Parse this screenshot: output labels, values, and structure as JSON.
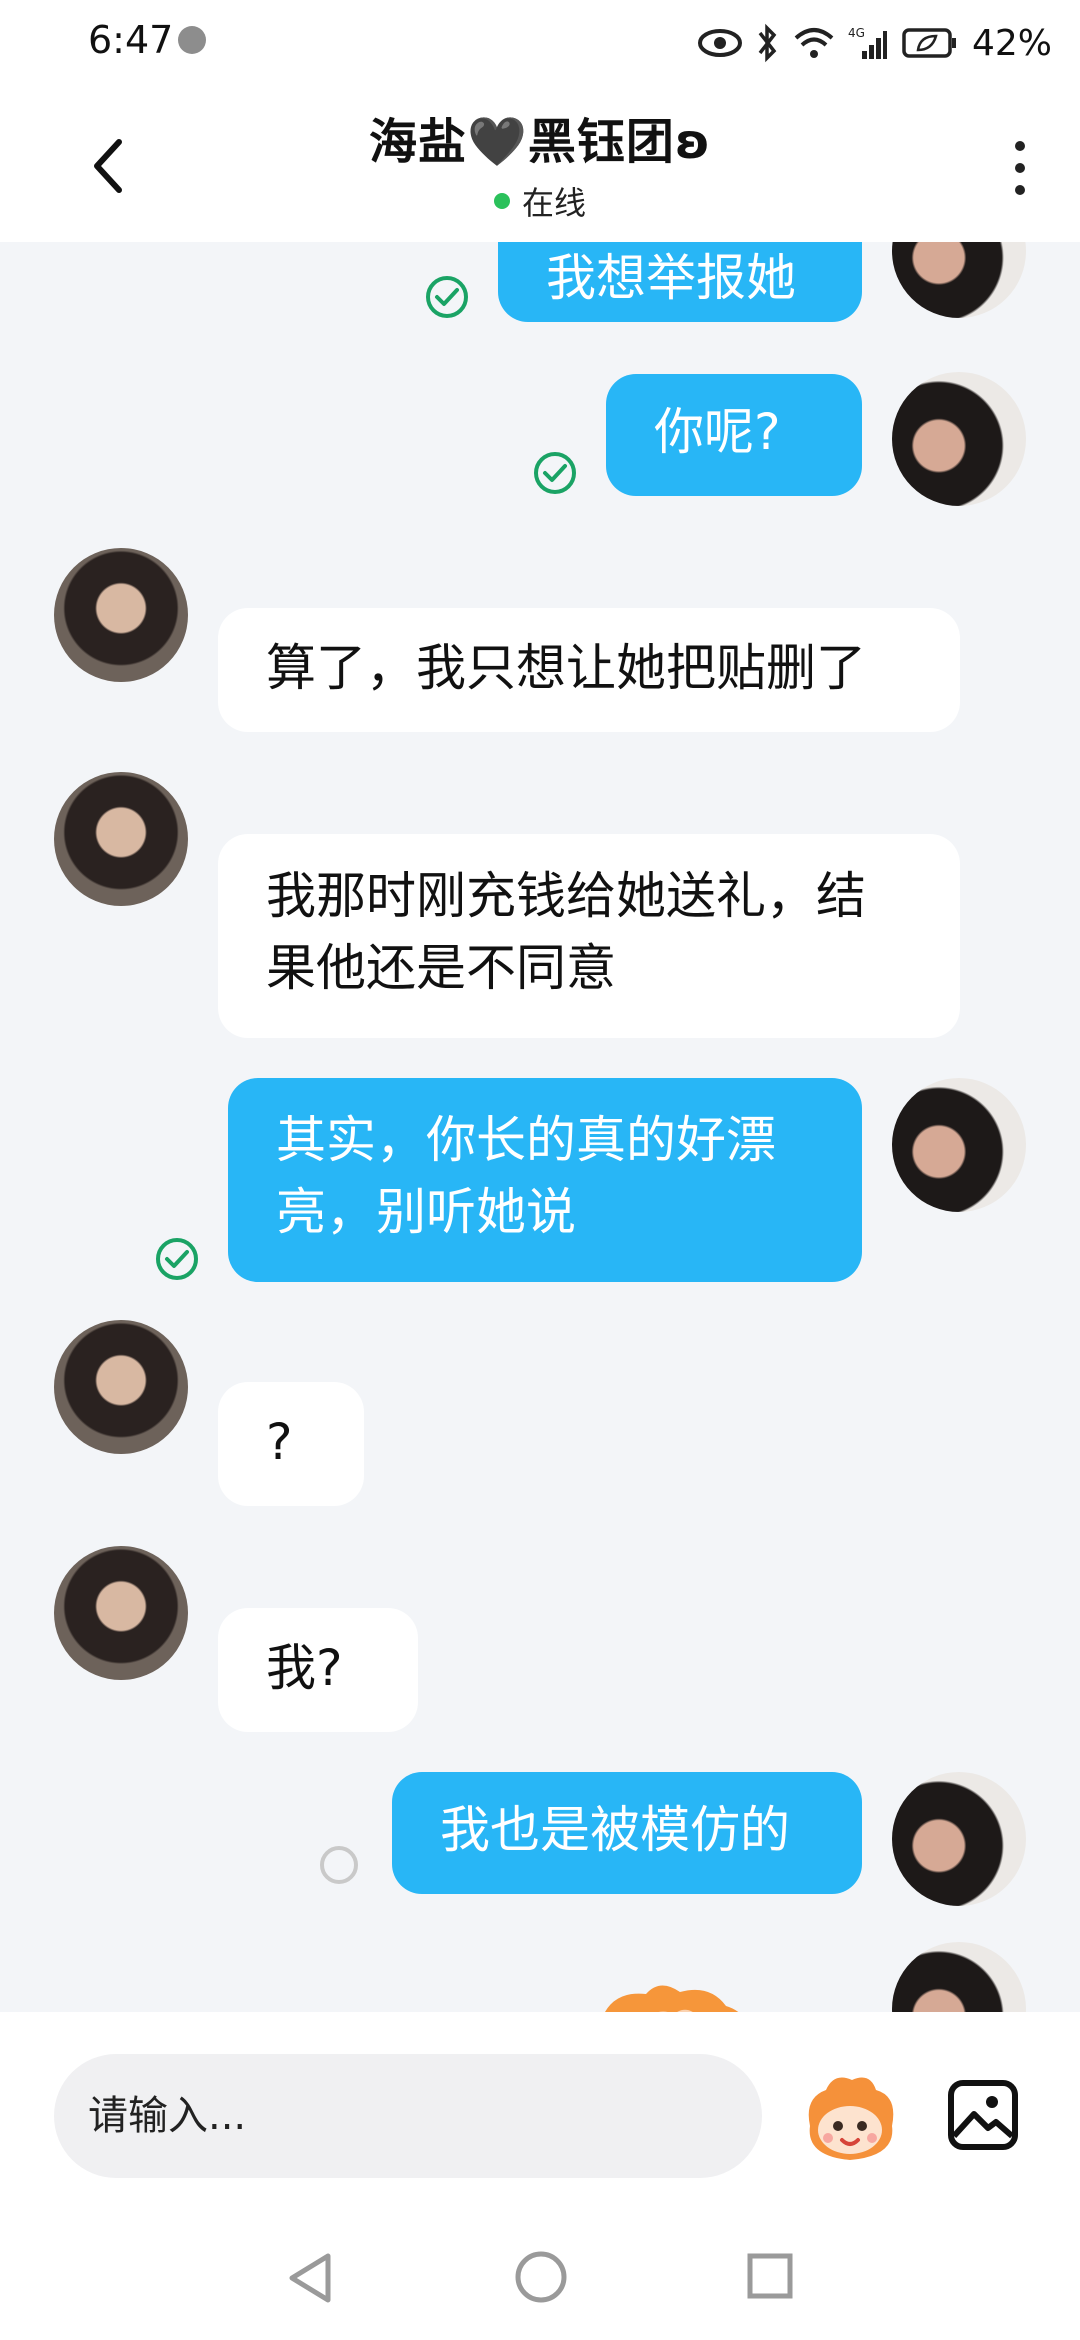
{
  "status_bar": {
    "time": "6:47",
    "network": "4G",
    "battery": "42%"
  },
  "header": {
    "title": "海盐🖤黑钰团ʚ",
    "status": "在线"
  },
  "messages": [
    {
      "direction": "outgoing",
      "text": "我想举报她",
      "status": "sent"
    },
    {
      "direction": "outgoing",
      "text": "你呢?",
      "status": "sent"
    },
    {
      "direction": "incoming",
      "text": "算了，我只想让她把贴删了"
    },
    {
      "direction": "incoming",
      "line1": "我那时刚充钱给她送礼，结",
      "line2": "果他还是不同意"
    },
    {
      "direction": "outgoing",
      "line1": "其实，你长的真的好漂",
      "line2": "亮，别听她说",
      "status": "sent"
    },
    {
      "direction": "incoming",
      "text": "?"
    },
    {
      "direction": "incoming",
      "text": "我?"
    },
    {
      "direction": "outgoing",
      "text": "我也是被模仿的",
      "status": "pending"
    }
  ],
  "input": {
    "placeholder": "请输入..."
  },
  "colors": {
    "accent": "#28b6f6",
    "online": "#2bc15b",
    "sent_check": "#1aa365",
    "background": "#f3f5f8"
  },
  "icons": [
    "back-arrow-icon",
    "more-vert-icon",
    "check-circle-icon",
    "emoji-sticker-icon",
    "image-icon",
    "nav-back-icon",
    "nav-home-icon",
    "nav-recent-icon"
  ]
}
